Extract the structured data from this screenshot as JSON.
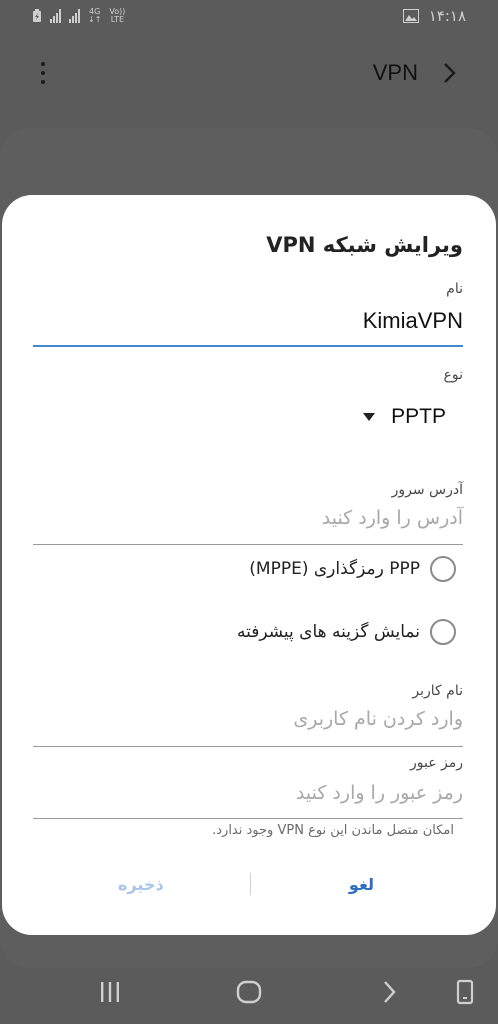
{
  "status_bar": {
    "network_type": "4G",
    "volte_label": "Vo))",
    "lte_label": "LTE",
    "time": "۱۴:۱۸"
  },
  "app_bar": {
    "title": "VPN"
  },
  "dialog": {
    "title": "ویرایش شبکه VPN",
    "name_label": "نام",
    "name_value": "KimiaVPN",
    "type_label": "نوع",
    "type_value": "PPTP",
    "server_label": "آدرس سرور",
    "server_placeholder": "آدرس را وارد کنید",
    "mppe_label": "PPP رمزگذاری (MPPE)",
    "advanced_label": "نمایش گزینه های پیشرفته",
    "username_label": "نام کاربر",
    "username_placeholder": "وارد کردن نام کاربری",
    "password_label": "رمز عبور",
    "password_placeholder": "رمز عبور را وارد کنید",
    "note": "امکان متصل ماندن این نوع VPN وجود ندارد.",
    "cancel_label": "لغو",
    "save_label": "ذخیره"
  },
  "colors": {
    "accent": "#3f8bd1",
    "cancel": "#2f6fc0",
    "save_disabled": "#a9c6e8",
    "scrim": "#5b5b5b"
  }
}
